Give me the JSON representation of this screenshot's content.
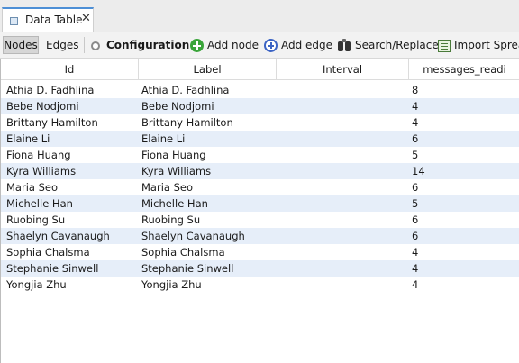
{
  "tab": {
    "title": "Data Table",
    "close": "✕"
  },
  "toolbar": {
    "nodes": "Nodes",
    "edges": "Edges",
    "configuration": "Configuration",
    "add_node": "Add node",
    "add_edge": "Add edge",
    "search_replace": "Search/Replace",
    "import": "Import Spread"
  },
  "table": {
    "columns": [
      "Id",
      "Label",
      "Interval",
      "messages_readi"
    ],
    "rows": [
      {
        "id": "Athia D. Fadhlina",
        "label": "Athia D. Fadhlina",
        "interval": "",
        "messages": "8"
      },
      {
        "id": "Bebe Nodjomi",
        "label": "Bebe Nodjomi",
        "interval": "",
        "messages": "4"
      },
      {
        "id": "Brittany Hamilton",
        "label": "Brittany Hamilton",
        "interval": "",
        "messages": "4"
      },
      {
        "id": "Elaine Li",
        "label": "Elaine Li",
        "interval": "",
        "messages": "6"
      },
      {
        "id": "Fiona Huang",
        "label": "Fiona Huang",
        "interval": "",
        "messages": "5"
      },
      {
        "id": "Kyra Williams",
        "label": "Kyra Williams",
        "interval": "",
        "messages": "14"
      },
      {
        "id": "Maria Seo",
        "label": "Maria Seo",
        "interval": "",
        "messages": "6"
      },
      {
        "id": "Michelle Han",
        "label": "Michelle Han",
        "interval": "",
        "messages": "5"
      },
      {
        "id": "Ruobing Su",
        "label": "Ruobing Su",
        "interval": "",
        "messages": "6"
      },
      {
        "id": "Shaelyn Cavanaugh",
        "label": "Shaelyn Cavanaugh",
        "interval": "",
        "messages": "6"
      },
      {
        "id": "Sophia Chalsma",
        "label": "Sophia Chalsma",
        "interval": "",
        "messages": "4"
      },
      {
        "id": "Stephanie Sinwell",
        "label": "Stephanie Sinwell",
        "interval": "",
        "messages": "4"
      },
      {
        "id": "Yongjia Zhu",
        "label": "Yongjia Zhu",
        "interval": "",
        "messages": "4"
      }
    ]
  },
  "colors": {
    "alt_row": "#e6eef9",
    "tab_accent": "#4d8fd6"
  }
}
